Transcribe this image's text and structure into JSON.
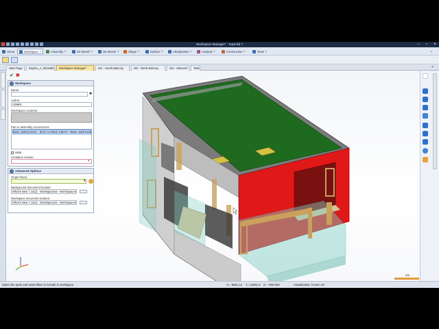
{
  "window": {
    "title": "Workspace Manager* - TopSolid 7"
  },
  "ribbon": {
    "tabs": [
      {
        "label": "Home",
        "color": "#3b6db3"
      },
      {
        "label": "Workspace",
        "color": "#3b6db3",
        "active": true
      },
      {
        "label": "Assembly",
        "color": "#4a8a3c"
      },
      {
        "label": "2D Sketch",
        "color": "#3b6db3"
      },
      {
        "label": "3D Sketch",
        "color": "#3b6db3"
      },
      {
        "label": "Shape",
        "color": "#c7662d"
      },
      {
        "label": "Surface",
        "color": "#3b6db3"
      },
      {
        "label": "Visualization",
        "color": "#3b6db3"
      },
      {
        "label": "Analysis",
        "color": "#a34e8c"
      },
      {
        "label": "Construction",
        "color": "#c7662d"
      },
      {
        "label": "Tools",
        "color": "#3b6db3"
      }
    ]
  },
  "doc_tabs": [
    {
      "label": "Start Page"
    },
    {
      "label": "Duplex_A_05115507"
    },
    {
      "label": "Workspace Manager*",
      "active": true
    },
    {
      "label": "W1 - South Balcony"
    },
    {
      "label": "W2 - North Balcony"
    },
    {
      "label": "W3 - Stairwell"
    },
    {
      "label": "Task"
    }
  ],
  "workspace_panel": {
    "title": "Workspace",
    "name_label": "Name:",
    "name_value": "",
    "author_label": "Author:",
    "author_value": "ADMIN",
    "contents_label": "Workspace contents:",
    "occurrences_label": "Part or assembly occurrences:",
    "occurrence_item": "Basic Wall:Exterior - Brick on Block:138237 <Basic Wall:Exterior -",
    "hide_label": "Hide",
    "limitation_label": "Limitation volume:",
    "limitation_value": ""
  },
  "advanced_panel": {
    "title": "Advanced Options",
    "origin_label": "Origin frame:",
    "origin_value": "",
    "background_label": "Background document location:",
    "background_value": "What's New 7.14(J) - Workspaces3 - WorkSpaces",
    "workspace_doc_label": "Workspace document location:",
    "workspace_doc_value": "What's New 7.14(J) - Workspaces3 - WorkSpaces"
  },
  "status": {
    "hint": "Select the parts and assemblies to include in workspace.",
    "x": "X= -8961.12",
    "y": "Y= 10061.0",
    "z": "Z= +000.000",
    "visualization": "Visualization: 0.2mm 15°",
    "scale": "2m"
  },
  "colors": {
    "roof": "#1e6a1f",
    "balcony_red": "#e01818",
    "wood": "#c9a15a",
    "glass": "#7fcfc3",
    "accent": "#3b6db3"
  }
}
